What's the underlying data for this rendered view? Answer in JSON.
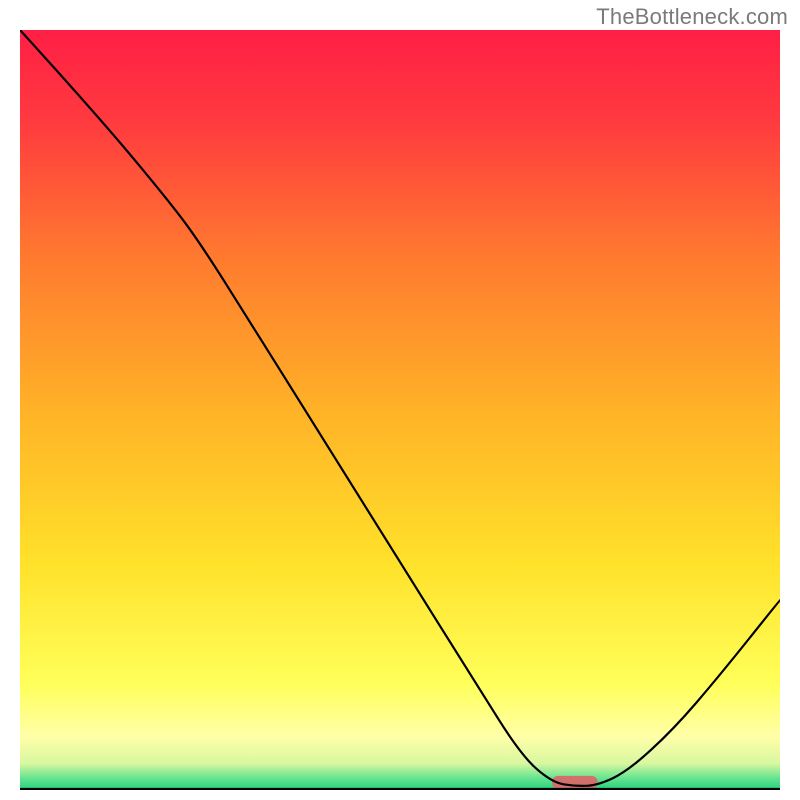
{
  "attribution": "TheBottleneck.com",
  "chart_data": {
    "type": "line",
    "title": "",
    "xlabel": "",
    "ylabel": "",
    "xlim": [
      0,
      100
    ],
    "ylim": [
      0,
      100
    ],
    "grid": false,
    "legend": false,
    "background_gradient_stops": [
      {
        "pos": 0.0,
        "color": "#ff1f45"
      },
      {
        "pos": 0.12,
        "color": "#ff3a3f"
      },
      {
        "pos": 0.3,
        "color": "#ff7a2f"
      },
      {
        "pos": 0.5,
        "color": "#ffb227"
      },
      {
        "pos": 0.7,
        "color": "#ffe12a"
      },
      {
        "pos": 0.86,
        "color": "#ffff5a"
      },
      {
        "pos": 0.93,
        "color": "#ffffa8"
      },
      {
        "pos": 0.965,
        "color": "#d8f7a0"
      },
      {
        "pos": 0.985,
        "color": "#62e38f"
      },
      {
        "pos": 1.0,
        "color": "#24cf7c"
      }
    ],
    "marker": {
      "x": 73,
      "y": 1,
      "width_pct": 6,
      "color": "#d2706b"
    },
    "series": [
      {
        "name": "curve",
        "stroke": "#000000",
        "points": [
          {
            "x": 0.0,
            "y": 100.0
          },
          {
            "x": 10.0,
            "y": 89.0
          },
          {
            "x": 20.0,
            "y": 77.0
          },
          {
            "x": 24.0,
            "y": 71.5
          },
          {
            "x": 30.0,
            "y": 62.0
          },
          {
            "x": 40.0,
            "y": 46.0
          },
          {
            "x": 50.0,
            "y": 30.0
          },
          {
            "x": 60.0,
            "y": 14.0
          },
          {
            "x": 66.0,
            "y": 4.5
          },
          {
            "x": 70.0,
            "y": 1.0
          },
          {
            "x": 73.0,
            "y": 0.5
          },
          {
            "x": 76.0,
            "y": 0.6
          },
          {
            "x": 80.0,
            "y": 2.5
          },
          {
            "x": 86.0,
            "y": 8.0
          },
          {
            "x": 92.0,
            "y": 15.0
          },
          {
            "x": 100.0,
            "y": 25.0
          }
        ]
      }
    ]
  }
}
